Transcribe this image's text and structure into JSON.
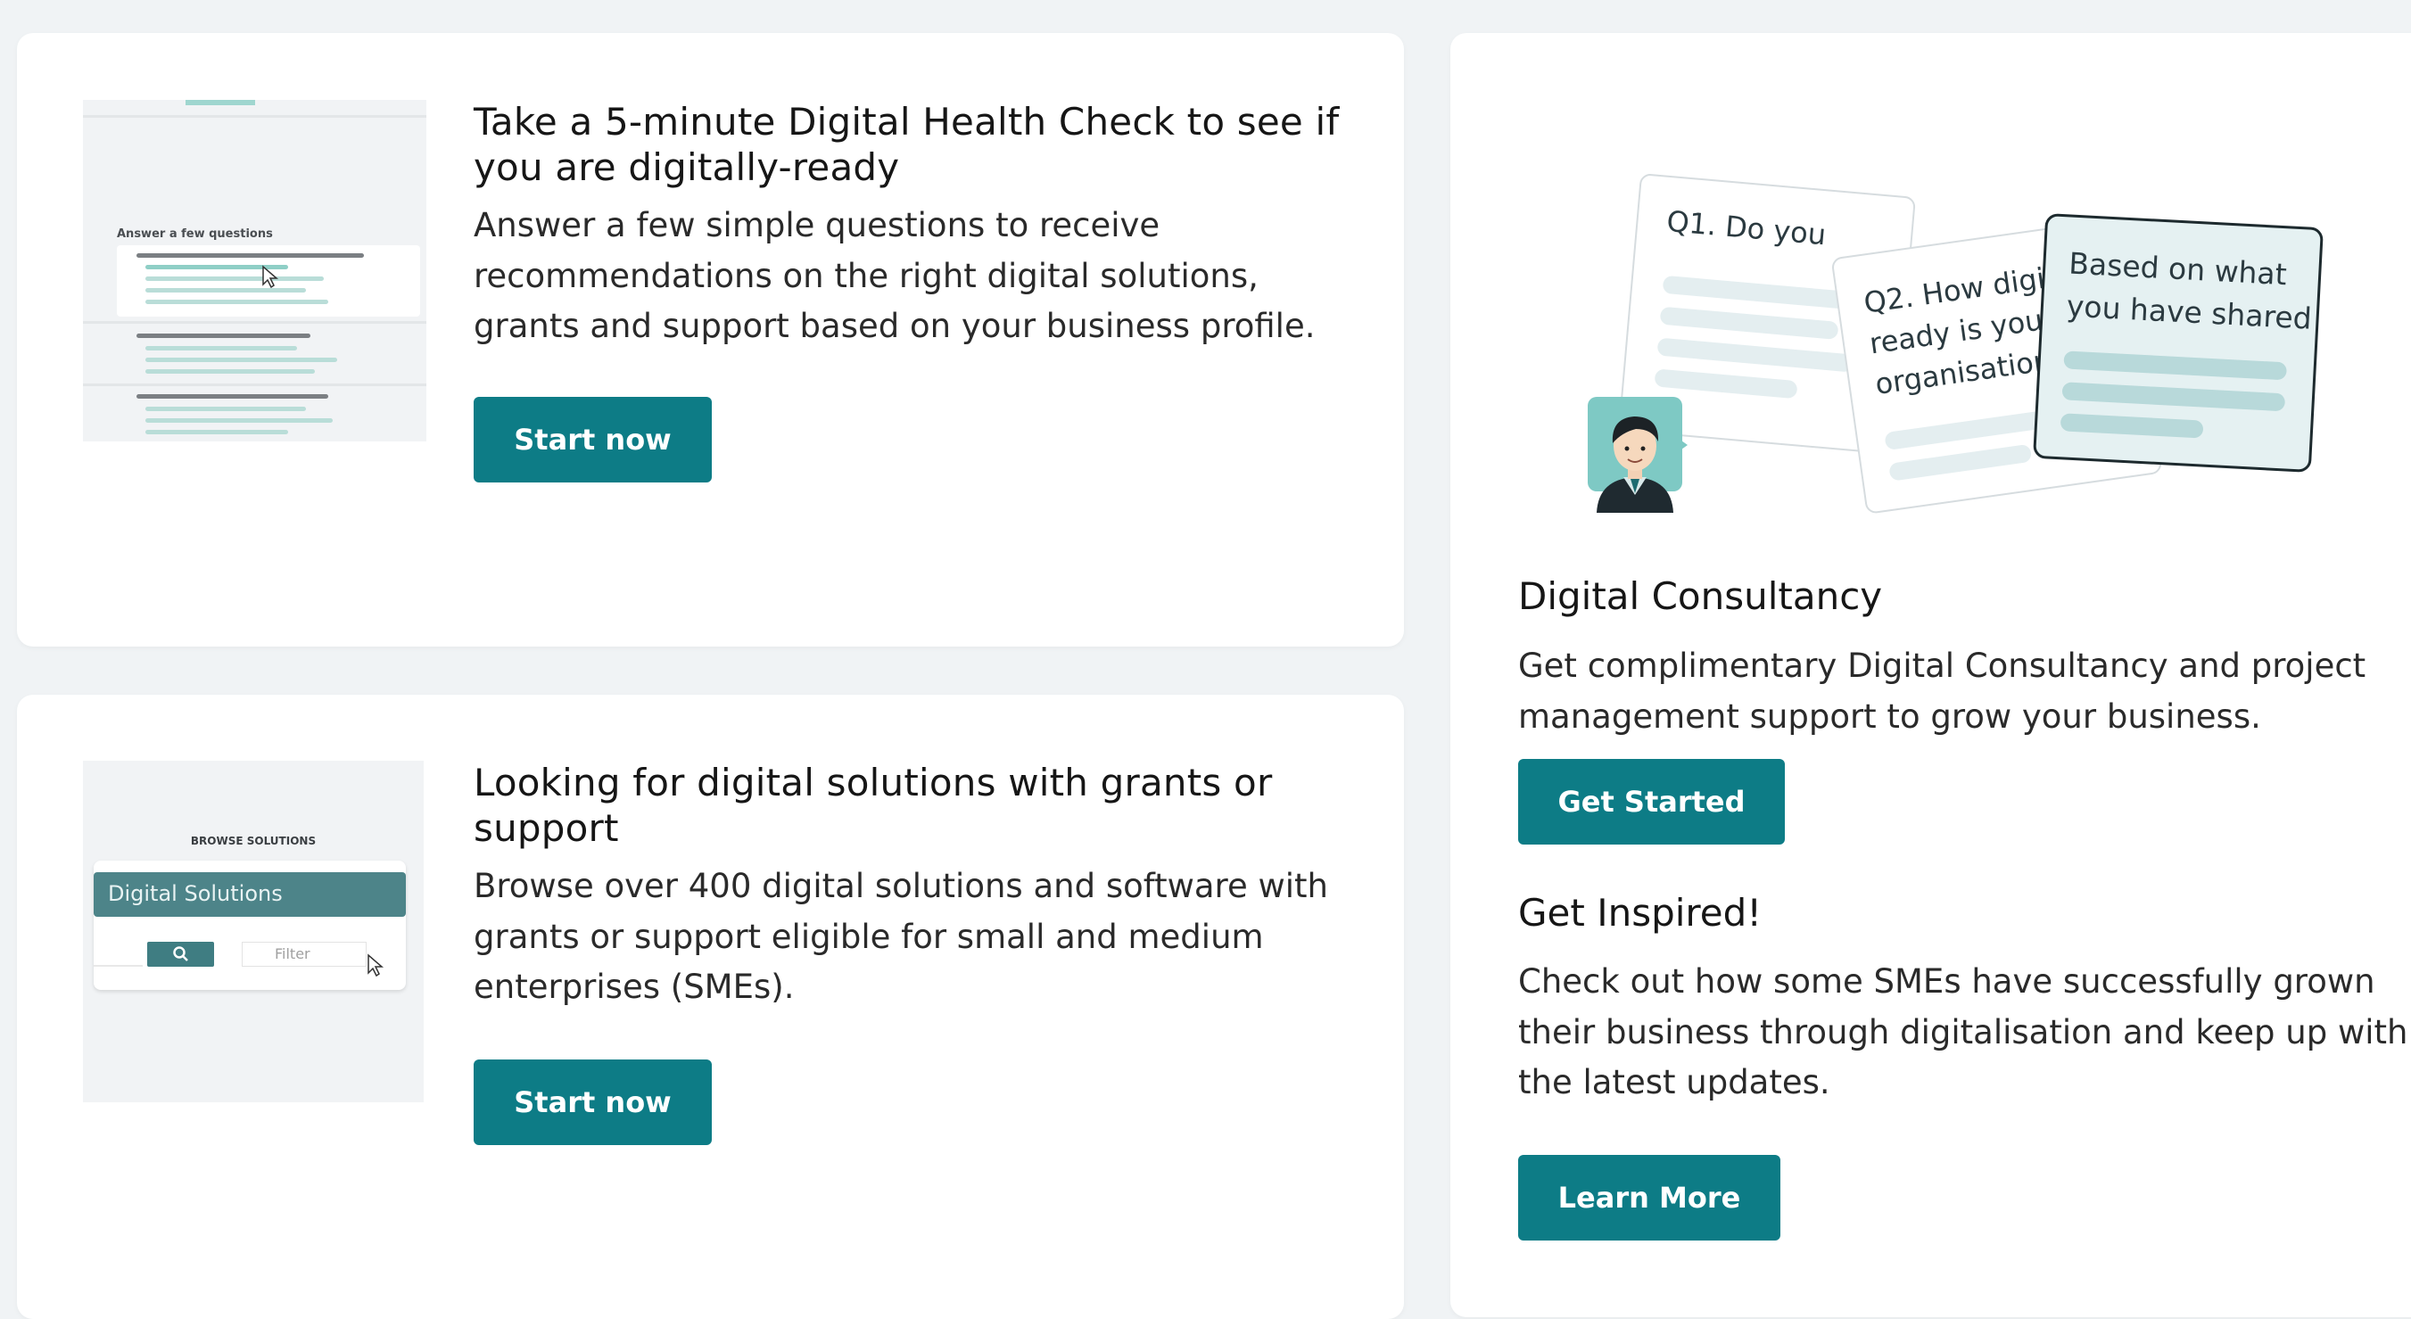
{
  "health_check": {
    "title": "Take a 5-minute Digital Health Check to see if you are digitally-ready",
    "description": "Answer a few simple questions to receive recommendations on the right digital solutions, grants and support based on your business profile.",
    "button_label": "Start now",
    "thumb_heading": "Answer a few questions"
  },
  "solutions": {
    "title": "Looking for digital solutions with grants or support",
    "description": "Browse over 400 digital solutions and software with grants or support eligible for small and medium enterprises (SMEs).",
    "button_label": "Start now",
    "thumb_heading": "BROWSE SOLUTIONS",
    "thumb_bar_label": "Digital Solutions",
    "thumb_filter": "Filter"
  },
  "illustration": {
    "card1": "Q1. Do you",
    "card2_lines": [
      "Q2. How digit",
      "ready is your",
      "organisation?"
    ],
    "card3_lines": [
      "Based on what",
      "you have shared"
    ]
  },
  "consultancy": {
    "title": "Digital Consultancy",
    "description": "Get complimentary Digital Consultancy and project management support to grow your business.",
    "button_label": "Get Started"
  },
  "inspired": {
    "title": "Get Inspired!",
    "description": "Check out how some SMEs have successfully grown their business through digitalisation and keep up with the latest updates.",
    "button_label": "Learn More"
  },
  "colors": {
    "accent": "#0d7c86",
    "card_bg": "#ffffff",
    "page_bg": "#f0f3f5"
  }
}
